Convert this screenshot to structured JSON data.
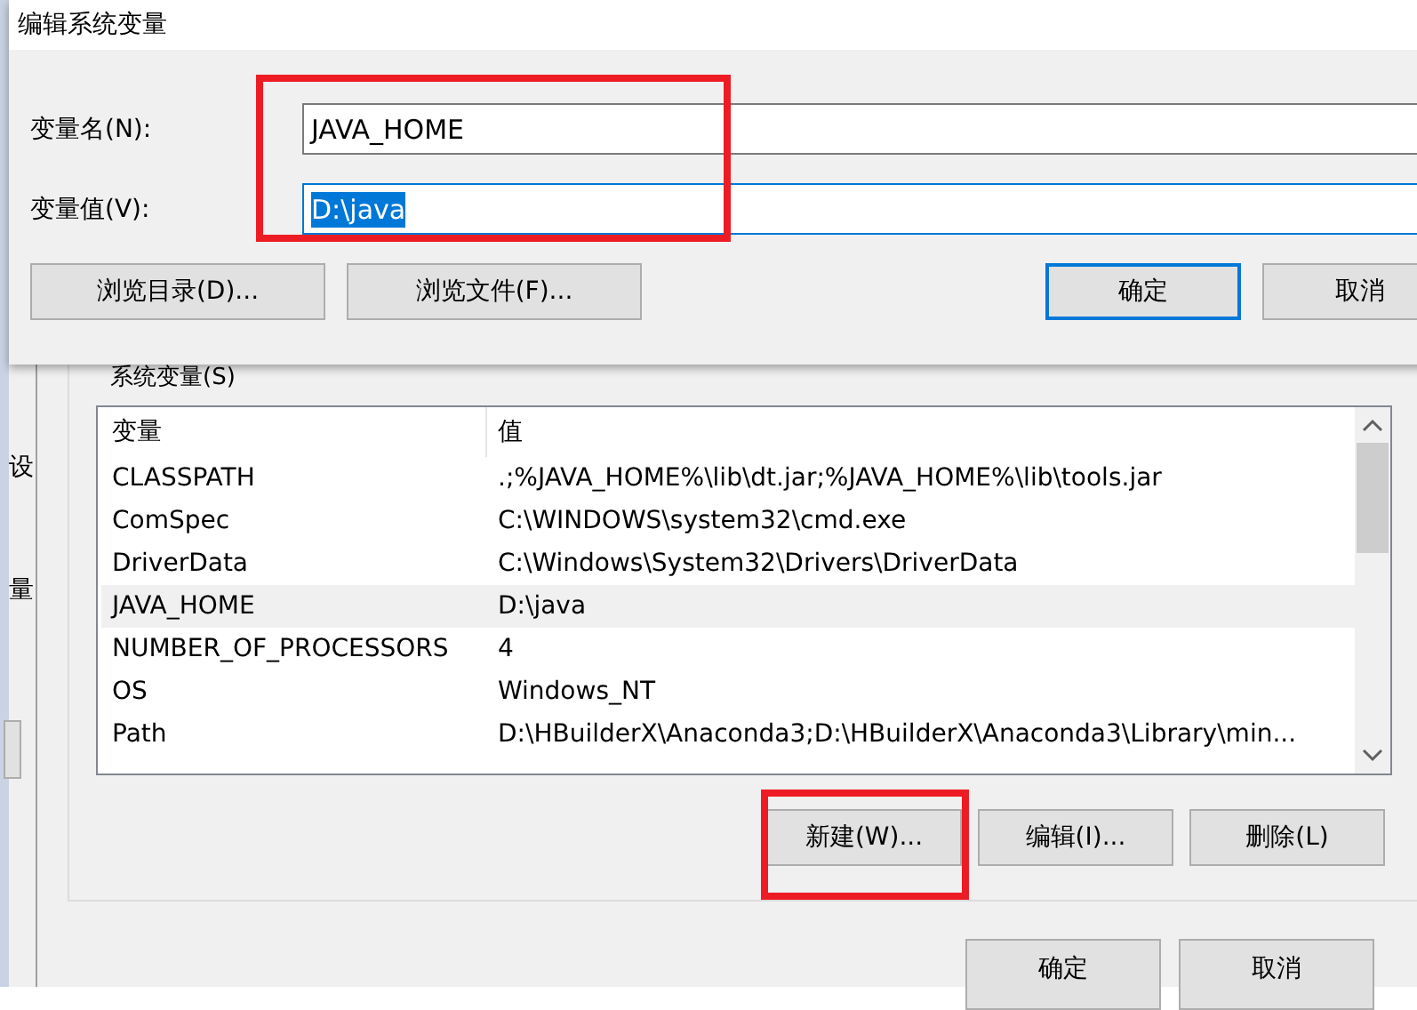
{
  "side_window": {
    "fragments": [
      "设",
      "量"
    ]
  },
  "environment_window": {
    "group_title": "系统变量(S)",
    "table": {
      "columns": [
        "变量",
        "值"
      ],
      "rows": [
        {
          "name": "CLASSPATH",
          "value": ".;%JAVA_HOME%\\lib\\dt.jar;%JAVA_HOME%\\lib\\tools.jar",
          "selected": false
        },
        {
          "name": "ComSpec",
          "value": "C:\\WINDOWS\\system32\\cmd.exe",
          "selected": false
        },
        {
          "name": "DriverData",
          "value": "C:\\Windows\\System32\\Drivers\\DriverData",
          "selected": false
        },
        {
          "name": "JAVA_HOME",
          "value": "D:\\java",
          "selected": true
        },
        {
          "name": "NUMBER_OF_PROCESSORS",
          "value": "4",
          "selected": false
        },
        {
          "name": "OS",
          "value": "Windows_NT",
          "selected": false
        },
        {
          "name": "Path",
          "value": "D:\\HBuilderX\\Anaconda3;D:\\HBuilderX\\Anaconda3\\Library\\min...",
          "selected": false
        }
      ]
    },
    "buttons": [
      "新建(W)...",
      "编辑(I)...",
      "删除(L)"
    ],
    "footer_buttons": [
      "确定",
      "取消"
    ]
  },
  "dialog": {
    "title": "编辑系统变量",
    "fields": [
      {
        "label": "变量名(N):",
        "value": "JAVA_HOME",
        "focused": false,
        "text_selected": false
      },
      {
        "label": "变量值(V):",
        "value": "D:\\java",
        "focused": true,
        "text_selected": true
      }
    ],
    "buttons": [
      {
        "label": "浏览目录(D)...",
        "default": false
      },
      {
        "label": "浏览文件(F)...",
        "default": false
      },
      {
        "label": "确定",
        "default": true
      },
      {
        "label": "取消",
        "default": false
      }
    ]
  }
}
